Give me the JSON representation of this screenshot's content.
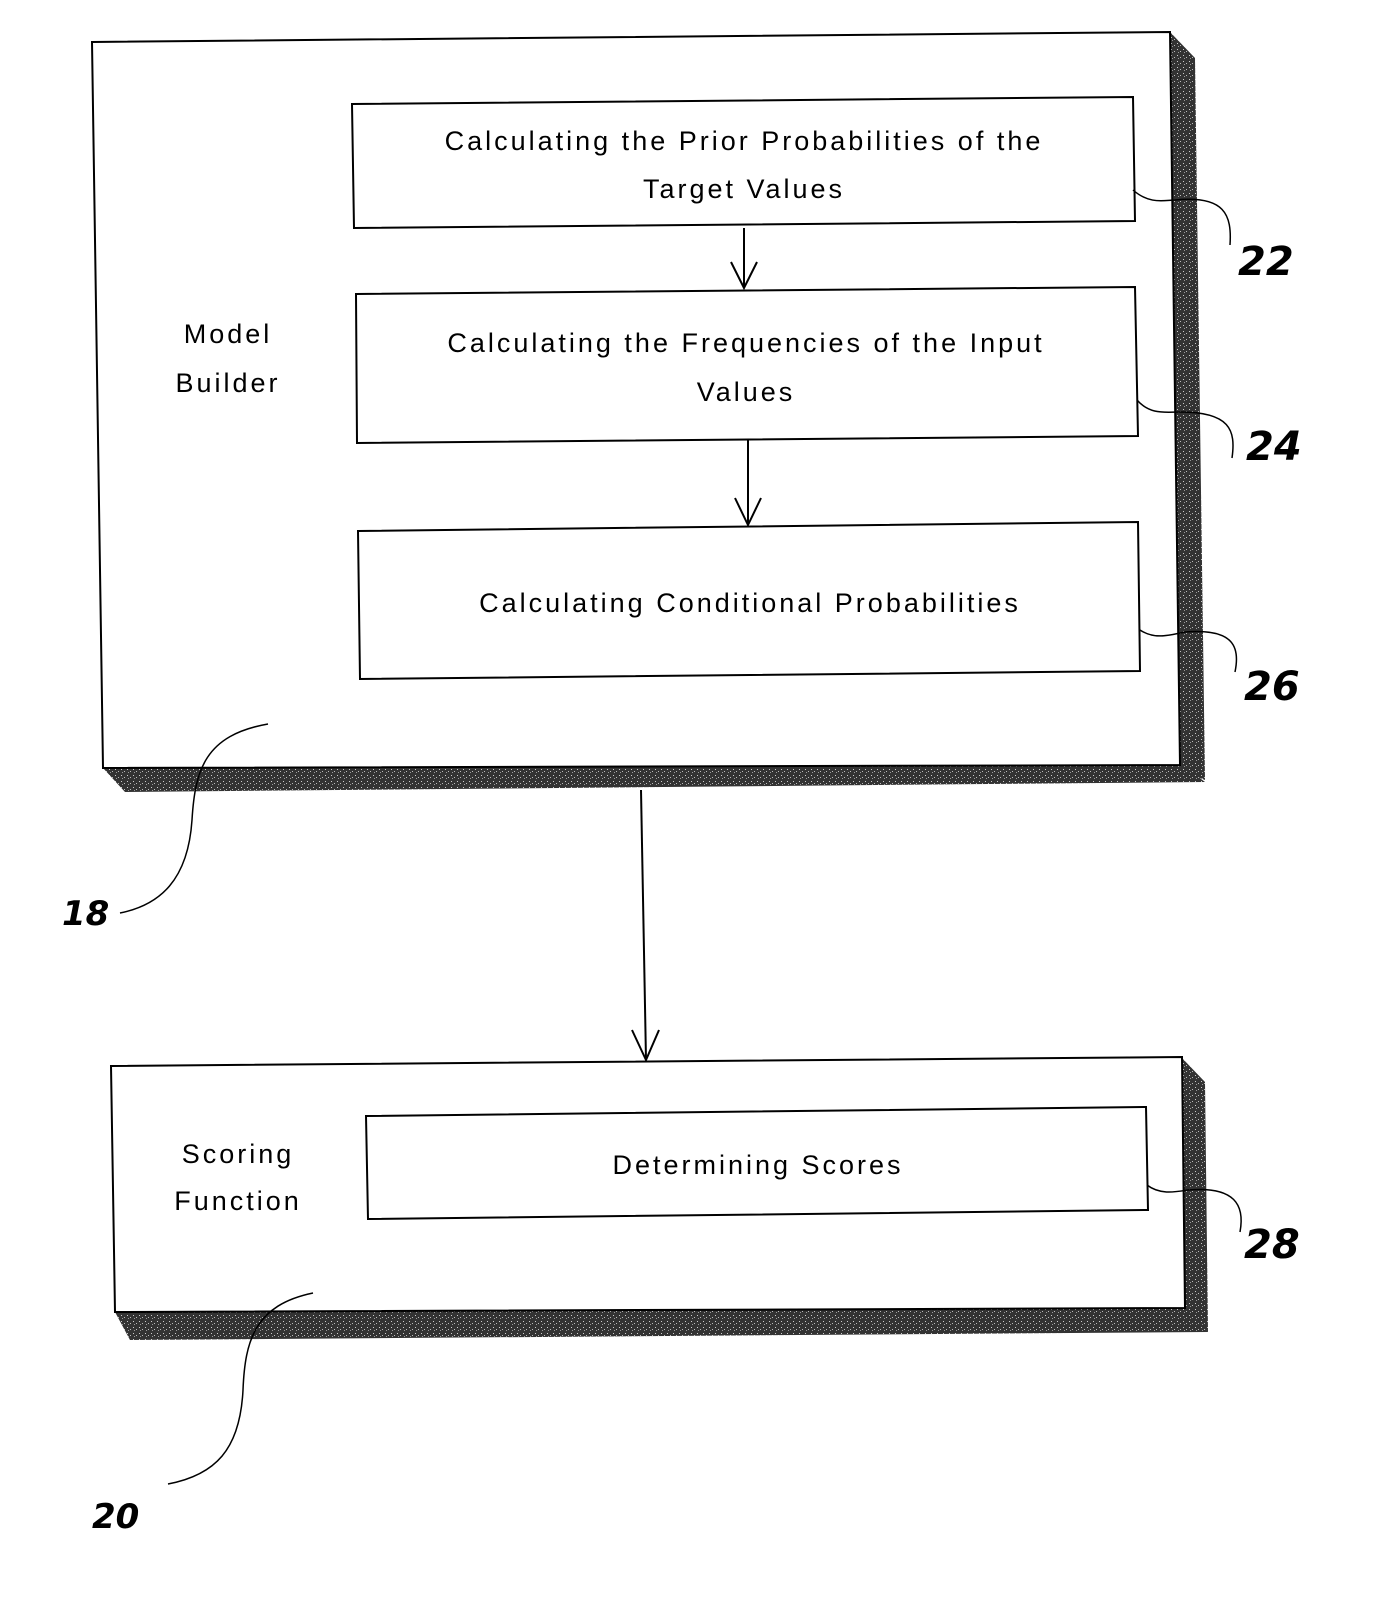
{
  "diagram": {
    "model_builder": {
      "label_lines": [
        "Model",
        "Builder"
      ],
      "ref": "18",
      "steps": [
        {
          "ref": "22",
          "lines": [
            "Calculating the Prior Probabilities of  the",
            "Target Values"
          ]
        },
        {
          "ref": "24",
          "lines": [
            "Calculating the Frequencies of the Input",
            "Values"
          ]
        },
        {
          "ref": "26",
          "lines": [
            "Calculating Conditional Probabilities"
          ]
        }
      ]
    },
    "scoring_function": {
      "label_lines": [
        "Scoring",
        "Function"
      ],
      "ref": "20",
      "steps": [
        {
          "ref": "28",
          "lines": [
            "Determining Scores"
          ]
        }
      ]
    },
    "colors": {
      "line": "#000000",
      "shadow": "#4a4a4a",
      "background": "#ffffff"
    }
  }
}
